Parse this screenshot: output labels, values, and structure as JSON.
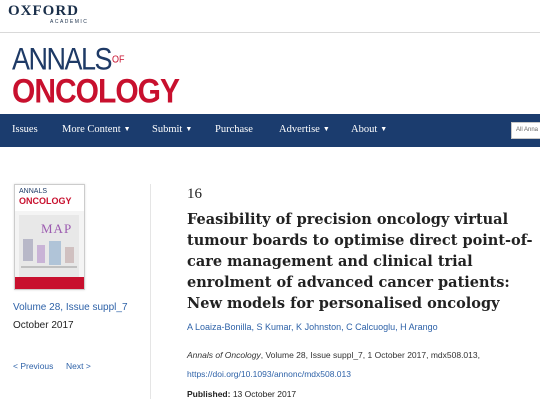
{
  "header": {
    "publisher": "OXFORD",
    "publisher_sub": "ACADEMIC",
    "journal_name_top": "ANNALS",
    "journal_name_of": "OF",
    "journal_name_bottom": "ONCOLOGY"
  },
  "nav": {
    "items": [
      {
        "label": "Issues",
        "has_dropdown": false
      },
      {
        "label": "More Content",
        "has_dropdown": true
      },
      {
        "label": "Submit",
        "has_dropdown": true
      },
      {
        "label": "Purchase",
        "has_dropdown": false
      },
      {
        "label": "Advertise",
        "has_dropdown": true
      },
      {
        "label": "About",
        "has_dropdown": true
      }
    ],
    "caret": "▼",
    "search_placeholder": "All Anna"
  },
  "issue": {
    "cover_title_top": "ANNALS",
    "cover_title_bottom": "ONCOLOGY",
    "cover_art_text": "MAP",
    "volume_link": "Volume 28, Issue suppl_7",
    "date": "October 2017",
    "prev_label": "< Previous",
    "next_label": "Next >"
  },
  "article": {
    "number": "16",
    "title": "Feasibility of precision oncology virtual tumour boards to optimise direct point-of-care management and clinical trial enrolment of advanced cancer patients: New models for personalised oncology",
    "authors": "A Loaiza-Bonilla, S Kumar, K Johnston, C Calcuoglu, H Arango",
    "citation_journal": "Annals of Oncology",
    "citation_rest": ", Volume 28, Issue suppl_7, 1 October 2017, mdx508.013,",
    "doi": "https://doi.org/10.1093/annonc/mdx508.013",
    "published_label": "Published:",
    "published_date": "13 October 2017"
  },
  "colors": {
    "nav_bg": "#1b3c6e",
    "brand_red": "#c8102e",
    "brand_blue": "#1e3a66",
    "link": "#2e62a8"
  }
}
